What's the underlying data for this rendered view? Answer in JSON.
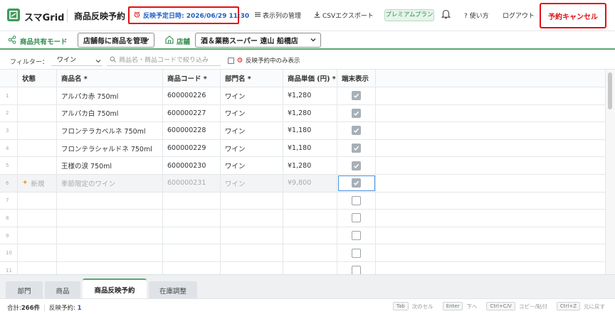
{
  "header": {
    "brand": "スマGrid",
    "page_title": "商品反映予約",
    "schedule_text": "反映予定日時: 2026/06/29 11:30",
    "nav_columns": "表示列の管理",
    "nav_export": "CSVエクスポート",
    "premium_badge": "プレミアムプラン",
    "nav_help": "? 使い方",
    "nav_logout": "ログアウト",
    "cancel_label": "予約キャンセル"
  },
  "modebar": {
    "mode_label": "商品共有モード",
    "mode_value": "店舗毎に商品を管理",
    "store_label": "店舗",
    "store_value": "酒＆業務スーパー 遠山 船橋店"
  },
  "filterbar": {
    "filter_label": "フィルター：",
    "filter_value": "ワイン",
    "search_placeholder": "商品名・商品コードで絞り込み",
    "only_reserved_label": "反映予約中のみ表示"
  },
  "grid": {
    "columns": [
      "状態",
      "商品名 *",
      "商品コード *",
      "部門名 *",
      "商品単価 (円) *",
      "端末表示"
    ],
    "rows": [
      {
        "num": "1",
        "status": "",
        "name": "アルパカ赤 750ml",
        "code": "600000226",
        "dept": "ワイン",
        "price": "¥1,280",
        "display": true
      },
      {
        "num": "2",
        "status": "",
        "name": "アルパカ白 750ml",
        "code": "600000227",
        "dept": "ワイン",
        "price": "¥1,280",
        "display": true
      },
      {
        "num": "3",
        "status": "",
        "name": "フロンテラカベルネ 750ml",
        "code": "600000228",
        "dept": "ワイン",
        "price": "¥1,180",
        "display": true
      },
      {
        "num": "4",
        "status": "",
        "name": "フロンテラシャルドネ 750ml",
        "code": "600000229",
        "dept": "ワイン",
        "price": "¥1,180",
        "display": true
      },
      {
        "num": "5",
        "status": "",
        "name": "王様の涙 750ml",
        "code": "600000230",
        "dept": "ワイン",
        "price": "¥1,280",
        "display": true
      },
      {
        "num": "6",
        "status": "新規",
        "name": "季節限定のワイン",
        "code": "600000231",
        "dept": "ワイン",
        "price": "¥9,800",
        "display": true
      },
      {
        "num": "7",
        "status": "",
        "name": "",
        "code": "",
        "dept": "",
        "price": "",
        "display": false
      },
      {
        "num": "8",
        "status": "",
        "name": "",
        "code": "",
        "dept": "",
        "price": "",
        "display": false
      },
      {
        "num": "9",
        "status": "",
        "name": "",
        "code": "",
        "dept": "",
        "price": "",
        "display": false
      },
      {
        "num": "10",
        "status": "",
        "name": "",
        "code": "",
        "dept": "",
        "price": "",
        "display": false
      },
      {
        "num": "11",
        "status": "",
        "name": "",
        "code": "",
        "dept": "",
        "price": "",
        "display": false
      }
    ]
  },
  "tabs": [
    {
      "label": "部門",
      "active": false
    },
    {
      "label": "商品",
      "active": false
    },
    {
      "label": "商品反映予約",
      "active": true
    },
    {
      "label": "在庫調整",
      "active": false
    }
  ],
  "status": {
    "total_label": "合計:",
    "total_value": "266件",
    "reserved_label": "反映予約:",
    "reserved_value": "1",
    "shortcuts": [
      {
        "key": "Tab",
        "desc": "次のセル"
      },
      {
        "key": "Enter",
        "desc": "下へ"
      },
      {
        "key": "Ctrl+C/V",
        "desc": "コピー/貼付"
      },
      {
        "key": "Ctrl+Z",
        "desc": "元に戻す"
      }
    ]
  },
  "colors": {
    "accent_green": "#3f9a5c",
    "alert_red": "#e01010",
    "link_blue": "#1f5fc2"
  }
}
